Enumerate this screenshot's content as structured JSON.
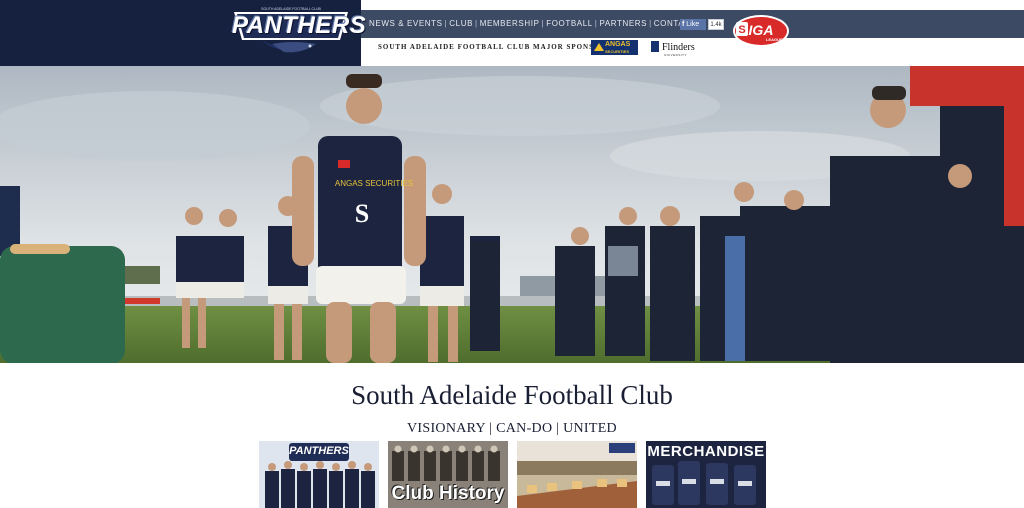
{
  "brand": {
    "logo_text": "PANTHERS",
    "logo_tagline": "SOUTH ADELAIDE FOOTBALL CLUB"
  },
  "nav": {
    "items": [
      "NEWS & EVENTS",
      "CLUB",
      "MEMBERSHIP",
      "FOOTBALL",
      "PARTNERS",
      "CONTACT"
    ],
    "separator": "|"
  },
  "social": {
    "like_label": "Like",
    "like_count": "1.4k"
  },
  "sponsors": {
    "line": "SOUTH ADELAIDE FOOTBALL CLUB MAJOR SPONSORS",
    "angas_name": "ANGAS",
    "angas_sub": "SECURITIES",
    "flinders_name": "Flinders",
    "flinders_sub": "UNIVERSITY",
    "iga_name": "IGA",
    "iga_sub": "LEAGUE"
  },
  "hero": {
    "jersey_sponsor": "ANGAS SECURITIES"
  },
  "main": {
    "title": "South Adelaide Football Club",
    "tagline": "VISIONARY | CAN-DO | UNITED"
  },
  "tiles": [
    {
      "label": "PANTHERS"
    },
    {
      "label": "Club History"
    },
    {
      "label": ""
    },
    {
      "label": "MERCHANDISE"
    }
  ],
  "colors": {
    "header_dark": "#15213f",
    "nav_bar": "#3d4a63",
    "text_dark": "#1a1f33",
    "iga_red": "#d92a2a"
  }
}
